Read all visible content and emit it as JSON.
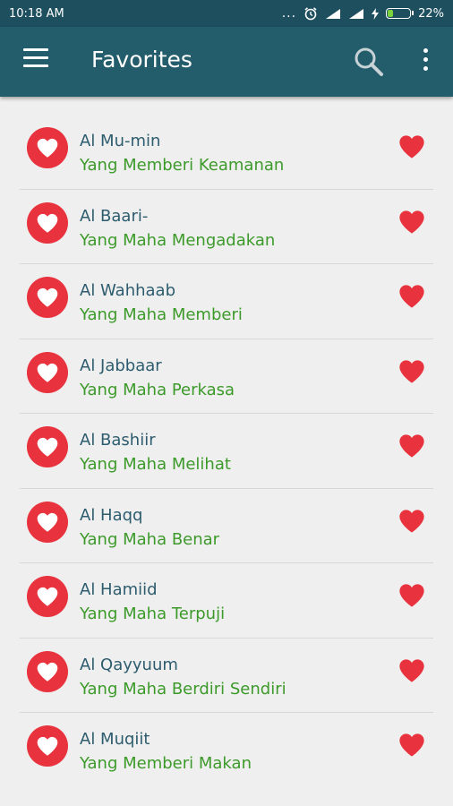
{
  "status_bar": {
    "time": "10:18 AM",
    "dots": "...",
    "battery_percent": "22%",
    "battery_level": 0.22
  },
  "app_bar": {
    "title": "Favorites",
    "color": "#235d6c"
  },
  "favorites": [
    {
      "name": "Al Mu-min",
      "meaning": "Yang Memberi Keamanan"
    },
    {
      "name": "Al Baari-",
      "meaning": "Yang Maha Mengadakan"
    },
    {
      "name": "Al Wahhaab",
      "meaning": "Yang Maha Memberi"
    },
    {
      "name": "Al Jabbaar",
      "meaning": "Yang Maha Perkasa"
    },
    {
      "name": "Al Bashiir",
      "meaning": "Yang Maha Melihat"
    },
    {
      "name": "Al Haqq",
      "meaning": "Yang Maha Benar"
    },
    {
      "name": "Al Hamiid",
      "meaning": "Yang Maha Terpuji"
    },
    {
      "name": "Al Qayyuum",
      "meaning": "Yang Maha Berdiri Sendiri"
    },
    {
      "name": "Al Muqiit",
      "meaning": "Yang Memberi Makan"
    }
  ],
  "colors": {
    "heart": "#e8323e",
    "name_text": "#2d5c6e",
    "meaning_text": "#3c9a2a",
    "status_bar": "#1d4f5f"
  },
  "icons": {
    "menu": "hamburger-menu-icon",
    "search": "search-icon",
    "more": "more-vert-icon",
    "avatar": "heart-icon",
    "favorite": "heart-filled-icon"
  }
}
